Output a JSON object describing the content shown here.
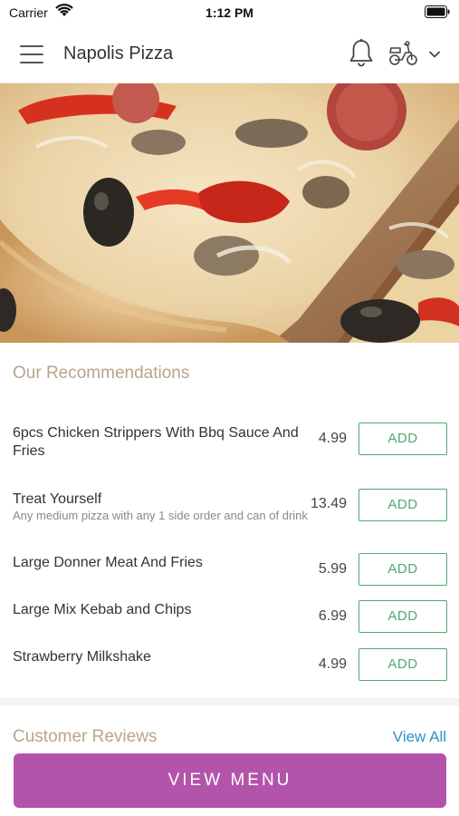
{
  "status_bar": {
    "carrier": "Carrier",
    "time": "1:12 PM"
  },
  "header": {
    "title": "Napolis Pizza",
    "icons": [
      "menu-icon",
      "bell-icon",
      "scooter-icon",
      "chevron-down-icon"
    ]
  },
  "hero": {
    "icon": "pizza-photo"
  },
  "recommendations": {
    "title": "Our Recommendations",
    "add_label": "ADD",
    "items": [
      {
        "name": "6pcs Chicken Strippers With Bbq Sauce And Fries",
        "description": "",
        "price": "4.99"
      },
      {
        "name": "Treat Yourself",
        "description": "Any medium pizza with any 1 side order and can of drink",
        "price": "13.49"
      },
      {
        "name": "Large Donner Meat And Fries",
        "description": "",
        "price": "5.99"
      },
      {
        "name": "Large Mix Kebab and Chips",
        "description": "",
        "price": "6.99"
      },
      {
        "name": "Strawberry Milkshake",
        "description": "",
        "price": "4.99"
      }
    ]
  },
  "reviews": {
    "title": "Customer Reviews",
    "view_all": "View All"
  },
  "footer": {
    "view_menu": "VIEW MENU"
  },
  "colors": {
    "accent_purple": "#b354ab",
    "add_green": "#4caa6e",
    "section_title": "#b8a58a",
    "link_blue": "#2c92c9"
  }
}
